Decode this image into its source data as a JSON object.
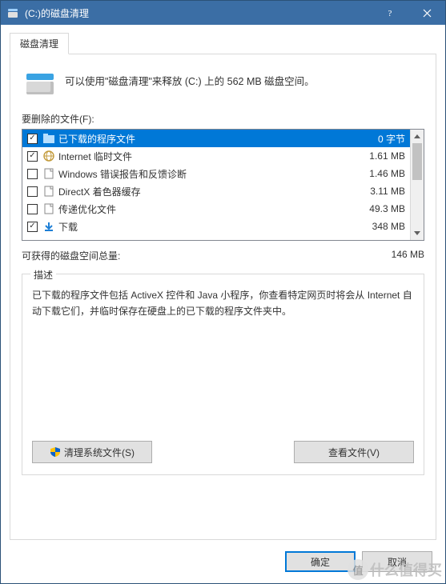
{
  "window": {
    "title": "(C:)的磁盘清理"
  },
  "tab": {
    "label": "磁盘清理"
  },
  "intro": {
    "text": "可以使用\"磁盘清理\"来释放  (C:) 上的 562 MB 磁盘空间。"
  },
  "filesToDelete": {
    "label": "要删除的文件(F):",
    "items": [
      {
        "checked": true,
        "icon": "folder",
        "name": "已下载的程序文件",
        "size": "0 字节",
        "selected": true
      },
      {
        "checked": true,
        "icon": "globe",
        "name": "Internet 临时文件",
        "size": "1.61 MB",
        "selected": false
      },
      {
        "checked": false,
        "icon": "file",
        "name": "Windows 错误报告和反馈诊断",
        "size": "1.46 MB",
        "selected": false
      },
      {
        "checked": false,
        "icon": "file",
        "name": "DirectX 着色器缓存",
        "size": "3.11 MB",
        "selected": false
      },
      {
        "checked": false,
        "icon": "file",
        "name": "传递优化文件",
        "size": "49.3 MB",
        "selected": false
      },
      {
        "checked": true,
        "icon": "download",
        "name": "下载",
        "size": "348 MB",
        "selected": false
      }
    ]
  },
  "total": {
    "label": "可获得的磁盘空间总量:",
    "value": "146 MB"
  },
  "description": {
    "legend": "描述",
    "text": "已下载的程序文件包括 ActiveX 控件和 Java 小程序，你查看特定网页时将会从 Internet 自动下载它们，并临时保存在硬盘上的已下载的程序文件夹中。"
  },
  "buttons": {
    "cleanSystem": "清理系统文件(S)",
    "viewFiles": "查看文件(V)",
    "ok": "确定",
    "cancel": "取消"
  },
  "watermark": {
    "text": "什么值得买",
    "badge": "值"
  }
}
